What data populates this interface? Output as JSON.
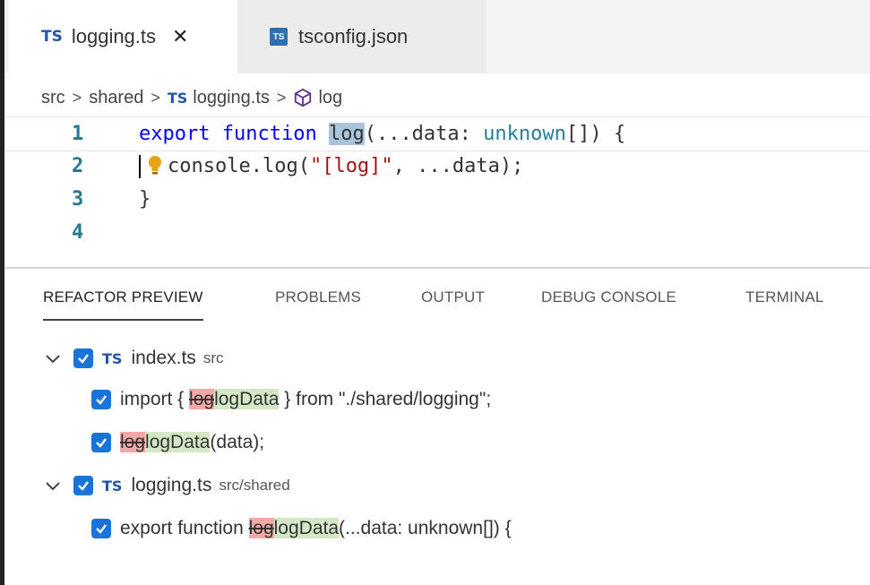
{
  "tabs": [
    {
      "icon": "TS",
      "label": "logging.ts",
      "close": "✕"
    },
    {
      "icon": "TS",
      "label": "tsconfig.json"
    }
  ],
  "breadcrumb": {
    "parts": [
      "src",
      "shared"
    ],
    "file_icon": "TS",
    "file": "logging.ts",
    "symbol": "log",
    "separator": ">"
  },
  "editor": {
    "line_numbers": [
      "1",
      "2",
      "3",
      "4"
    ],
    "line1": {
      "kw1": "export",
      "kw2": "function",
      "name": "log",
      "rest1": "(...data: ",
      "type": "unknown",
      "rest2": "[]) {"
    },
    "line2": {
      "pre": "console.log(",
      "str": "\"[log]\"",
      "post": ", ...data);"
    },
    "line3": "}",
    "line4": ""
  },
  "panel_tabs": [
    "REFACTOR PREVIEW",
    "PROBLEMS",
    "OUTPUT",
    "DEBUG CONSOLE",
    "TERMINAL"
  ],
  "refactor": {
    "files": [
      {
        "icon": "TS",
        "name": "index.ts",
        "path": "src",
        "changes": [
          {
            "pre": "import { ",
            "old": "log",
            "new": "logData",
            "post": " } from \"./shared/logging\";"
          },
          {
            "pre": "",
            "old": "log",
            "new": "logData",
            "post": "(data);"
          }
        ]
      },
      {
        "icon": "TS",
        "name": "logging.ts",
        "path": "src/shared",
        "changes": [
          {
            "pre": "export function ",
            "old": "log",
            "new": "logData",
            "post": "(...data: unknown[]) {"
          }
        ]
      }
    ]
  },
  "colors": {
    "checkbox": "#1a73d6",
    "deleted": "#f4a9a9",
    "inserted": "#d5e8c5",
    "ts_icon": "#1f57a8"
  },
  "icons": [
    "close-icon",
    "json-file-icon",
    "symbol-method-icon",
    "lightbulb-icon",
    "chevron-down-icon",
    "checkbox-checked-icon"
  ]
}
